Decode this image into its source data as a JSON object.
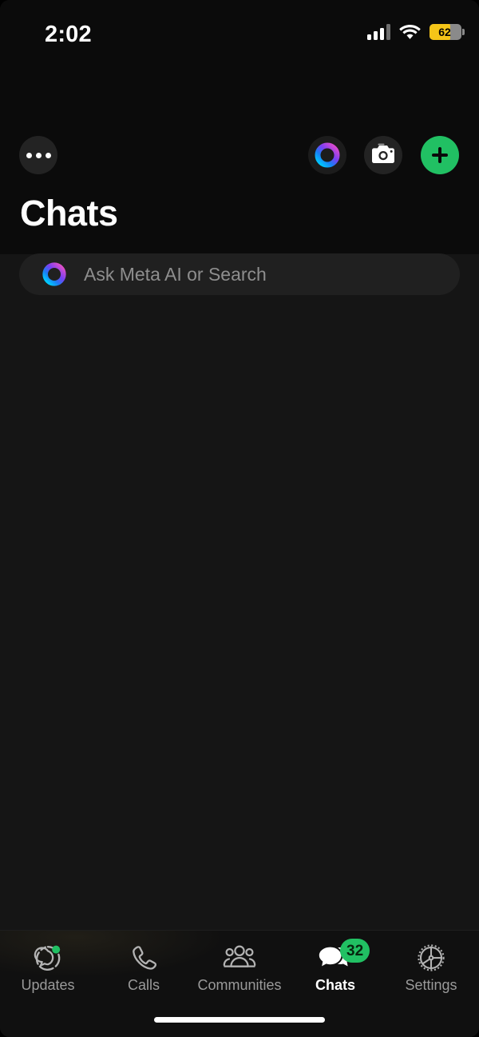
{
  "status_bar": {
    "time": "2:02",
    "signal_icon": "cellular-signal-icon",
    "wifi_icon": "wifi-icon",
    "battery_icon": "battery-icon",
    "battery_percent": "62",
    "battery_fill_color": "#f5c518"
  },
  "header": {
    "menu_label": "•••",
    "menu_icon": "more-options-icon",
    "meta_ai_icon": "meta-ai-ring-icon",
    "camera_icon": "camera-icon",
    "new_chat_icon": "plus-icon",
    "title": "Chats"
  },
  "search": {
    "placeholder": "Ask Meta AI or Search",
    "icon": "meta-ai-ring-icon"
  },
  "chat_list": {
    "items": [],
    "empty": true
  },
  "tabs": [
    {
      "label": "Updates",
      "icon": "updates-status-ring-icon",
      "active": false,
      "dot": true,
      "badge": ""
    },
    {
      "label": "Calls",
      "icon": "phone-icon",
      "active": false,
      "dot": false,
      "badge": ""
    },
    {
      "label": "Communities",
      "icon": "communities-people-icon",
      "active": false,
      "dot": false,
      "badge": ""
    },
    {
      "label": "Chats",
      "icon": "chat-bubbles-icon",
      "active": true,
      "dot": false,
      "badge": "32"
    },
    {
      "label": "Settings",
      "icon": "gear-icon",
      "active": false,
      "dot": false,
      "badge": ""
    }
  ],
  "colors": {
    "accent_green": "#21c063",
    "header_bg": "#0b0b0b",
    "body_bg": "#151515",
    "search_bg": "#202020",
    "inactive_text": "#9a9a9a"
  }
}
